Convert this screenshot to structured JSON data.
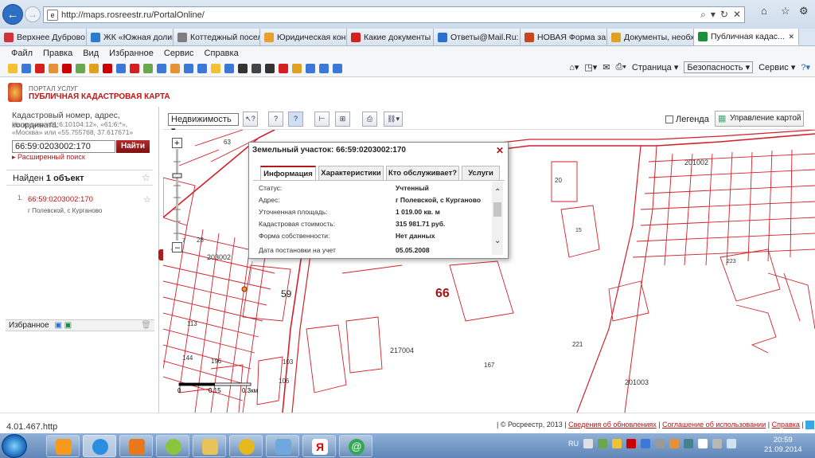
{
  "browser": {
    "url": "http://maps.rosreestr.ru/PortalOnline/",
    "tabs": [
      {
        "label": "Верхнее Дуброво - ...",
        "color": "#d6303a"
      },
      {
        "label": "ЖК «Южная долина...",
        "color": "#2a7bd1"
      },
      {
        "label": "Коттеджный поселок...",
        "color": "#7e7e7e"
      },
      {
        "label": "Юридическая консу...",
        "color": "#e8a02a"
      },
      {
        "label": "Какие документы кр...",
        "color": "#d62020"
      },
      {
        "label": "Ответы@Mail.Ru: ка...",
        "color": "#2a6fd1"
      },
      {
        "label": "НОВАЯ Форма запр...",
        "color": "#c9461c"
      },
      {
        "label": "Документы, необхо...",
        "color": "#e0a020"
      },
      {
        "label": "Публичная кадас...",
        "color": "#1b8f3c",
        "active": true
      }
    ],
    "menu": [
      "Файл",
      "Правка",
      "Вид",
      "Избранное",
      "Сервис",
      "Справка"
    ],
    "right_menu": {
      "page": "Страница ▾",
      "security": "Безопасность ▾",
      "service": "Сервис ▾"
    }
  },
  "portal": {
    "subtitle": "ПОРТАЛ УСЛУГ",
    "title": "ПУБЛИЧНАЯ КАДАСТРОВАЯ КАРТА"
  },
  "search": {
    "hint": "Кадастровый номер, адрес, координата:",
    "example": "Например «61:6:10104:12», «61:6:*», «Москва» или «55.755768, 37.617671»",
    "value": "66:59:0203002:170",
    "button": "Найти",
    "advanced": "▸ Расширенный поиск"
  },
  "results": {
    "found_prefix": "Найден",
    "found_count": "1 объект",
    "items": [
      {
        "num": "1.",
        "id": "66:59:0203002:170",
        "address": "г Полевской, с Курганово"
      }
    ],
    "favorites_label": "Избранное"
  },
  "map_toolbar": {
    "layer_select": "Недвижимость",
    "legend_label": "Легенда",
    "map_control": "Управление картой"
  },
  "popup": {
    "title": "Земельный участок: 66:59:0203002:170",
    "tabs": [
      "Информация",
      "Характеристики",
      "Кто обслуживает?",
      "Услуги"
    ],
    "rows": [
      {
        "label": "Статус:",
        "value": "Учтенный"
      },
      {
        "label": "Адрес:",
        "value": "г Полевской, с Курганово"
      },
      {
        "label": "Уточненная площадь:",
        "value": "1 019.00 кв. м"
      },
      {
        "label": "Кадастровая стоимость:",
        "value": "315 981.71 руб."
      },
      {
        "label": "Форма собственности:",
        "value": "Нет данных"
      },
      {
        "label": "Дата постановки на учет",
        "value": "05.05.2008"
      }
    ]
  },
  "map_labels": {
    "l1": "63",
    "l2": "20",
    "l3": "201002",
    "l4": "28",
    "l5": "203002",
    "l6": "59",
    "l7": "66",
    "l8": "113",
    "l9": "217004",
    "l10": "221",
    "l11": "144",
    "l12": "196",
    "l13": "103",
    "l14": "167",
    "l15": "106",
    "l16": "201003",
    "l17": "223",
    "l18": "15",
    "l19": "7"
  },
  "scale": {
    "s0": "0",
    "s1": "0.15",
    "s2": "0.3км"
  },
  "status": {
    "left": "4.01.467.http",
    "copyright": "| © Росреестр, 2013 |",
    "link1": "Сведения об обновлениях",
    "link2": "Соглашение об использовании",
    "link3": "Справка",
    "sep": "|"
  },
  "taskbar": {
    "lang": "RU",
    "time": "20:59",
    "date": "21.09.2014"
  },
  "colors": {
    "accent": "#b21b1b",
    "map_line": "#d4202a"
  }
}
